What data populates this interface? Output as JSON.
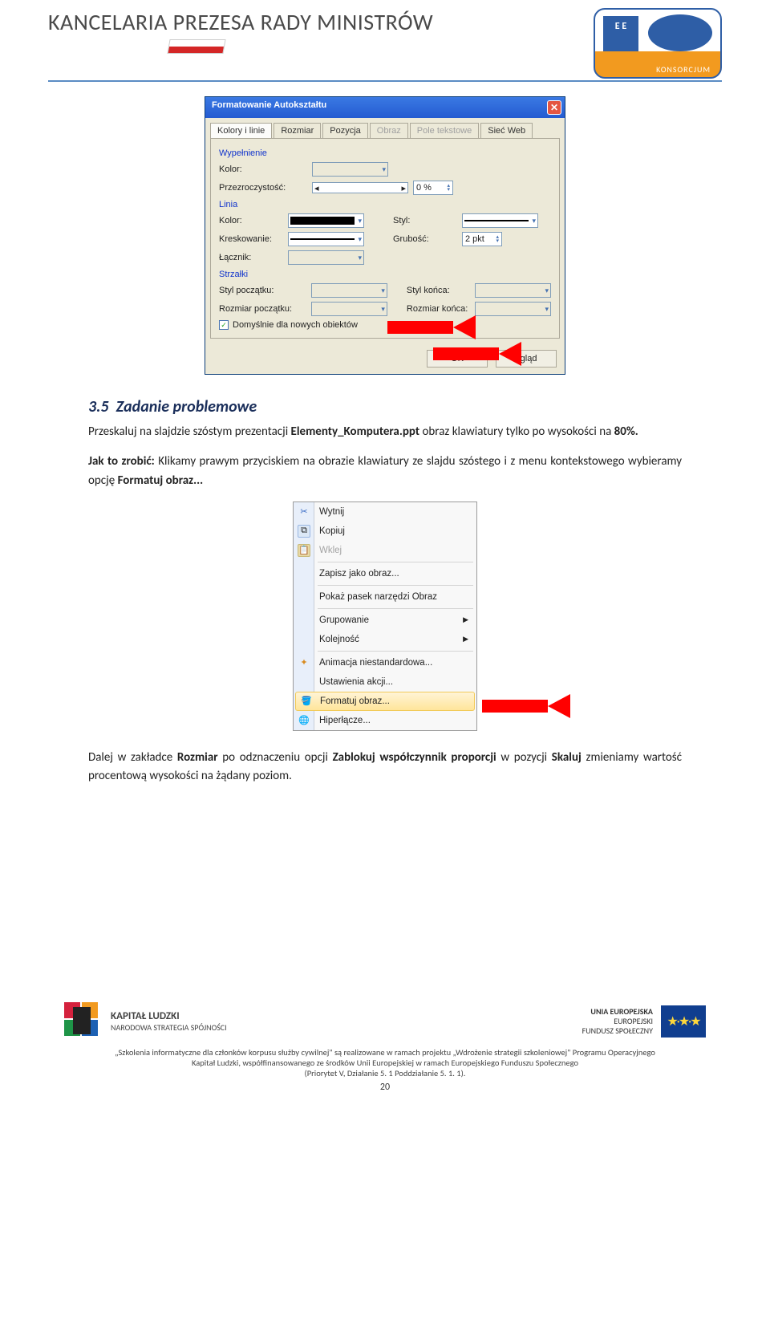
{
  "header": {
    "title": "KANCELARIA PREZESA RADY MINISTRÓW",
    "logo_ee": "E E",
    "logo_konsorcjum": "KONSORCJUM"
  },
  "dialog": {
    "title": "Formatowanie Autokształtu",
    "tabs": [
      "Kolory i linie",
      "Rozmiar",
      "Pozycja",
      "Obraz",
      "Pole tekstowe",
      "Sieć Web"
    ],
    "fill_section": "Wypełnienie",
    "color_lbl": "Kolor:",
    "transparency_lbl": "Przezroczystość:",
    "transparency_val": "0 %",
    "line_section": "Linia",
    "style_lbl": "Styl:",
    "dash_lbl": "Kreskowanie:",
    "weight_lbl": "Grubość:",
    "weight_val": "2 pkt",
    "connector_lbl": "Łącznik:",
    "arrows_section": "Strzałki",
    "begin_style_lbl": "Styl początku:",
    "end_style_lbl": "Styl końca:",
    "begin_size_lbl": "Rozmiar początku:",
    "end_size_lbl": "Rozmiar końca:",
    "default_chk": "Domyślnie dla nowych obiektów",
    "ok": "OK",
    "preview": "dgląd"
  },
  "h_num": "3.5",
  "h_title": "Zadanie problemowe",
  "para1_a": "Przeskaluj na slajdzie szóstym prezentacji ",
  "para1_b": "Elementy_Komputera.ppt",
  "para1_c": " obraz klawiatury tylko po wysokości na ",
  "para1_d": "80%.",
  "para2_a": "Jak to zrobić:",
  "para2_b": " Klikamy prawym przyciskiem na obrazie klawiatury ze slajdu szóstego i z menu kontekstowego wybieramy opcję ",
  "para2_c": "Formatuj obraz...",
  "ctx": {
    "cut": "Wytnij",
    "copy": "Kopiuj",
    "paste": "Wklej",
    "save_img": "Zapisz jako obraz...",
    "show_toolbar": "Pokaż pasek narzędzi Obraz",
    "group": "Grupowanie",
    "order": "Kolejność",
    "anim": "Animacja niestandardowa...",
    "action": "Ustawienia akcji...",
    "format": "Formatuj obraz...",
    "hyperlink": "Hiperłącze..."
  },
  "para3_a": "Dalej w zakładce ",
  "para3_b": "Rozmiar",
  "para3_c": " po odznaczeniu opcji ",
  "para3_d": "Zablokuj współczynnik proporcji",
  "para3_e": " w pozycji ",
  "para3_f": "Skaluj",
  "para3_g": " zmieniamy wartość procentową wysokości na żądany poziom.",
  "footer": {
    "kl_title": "KAPITAŁ LUDZKI",
    "kl_sub": "NARODOWA STRATEGIA SPÓJNOŚCI",
    "ue_l1": "UNIA EUROPEJSKA",
    "ue_l2": "EUROPEJSKI",
    "ue_l3": "FUNDUSZ SPOŁECZNY",
    "line1": "„Szkolenia informatyczne dla członków korpusu służby cywilnej\" są realizowane w ramach projektu „Wdrożenie strategii szkoleniowej\" Programu Operacyjnego",
    "line2": "Kapitał Ludzki, współfinansowanego ze środków Unii Europejskiej w ramach Europejskiego Funduszu Społecznego",
    "line3": "(Priorytet V, Działanie 5. 1 Poddziałanie 5. 1. 1).",
    "pageno": "20"
  }
}
